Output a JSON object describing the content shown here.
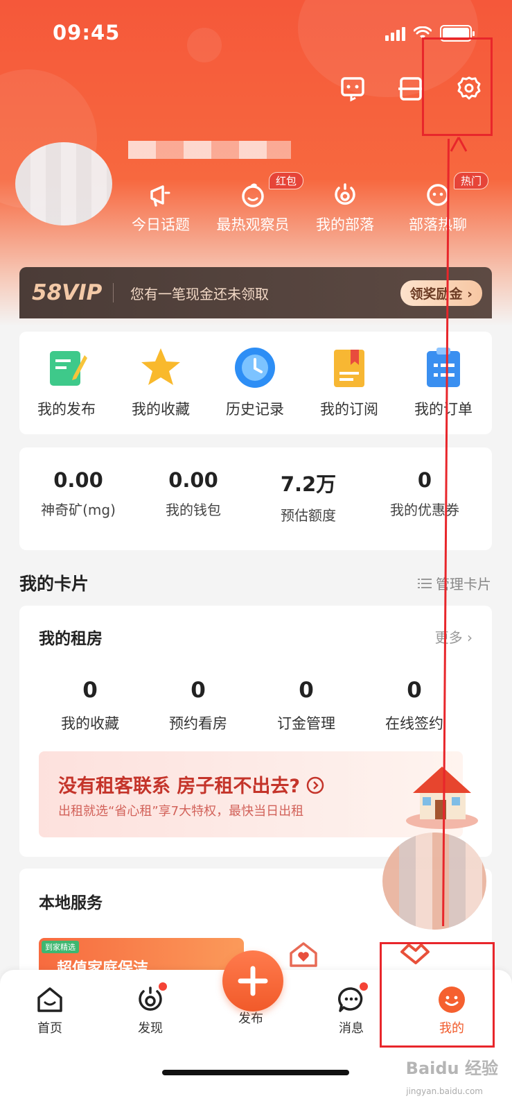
{
  "status_bar": {
    "time": "09:45"
  },
  "quick_links": [
    {
      "label": "今日话题",
      "icon": "megaphone-icon"
    },
    {
      "label": "最热观察员",
      "icon": "smile-bubble-icon",
      "badge": "红包"
    },
    {
      "label": "我的部落",
      "icon": "tribe-icon"
    },
    {
      "label": "部落热聊",
      "icon": "chat-face-icon",
      "badge": "热门"
    }
  ],
  "vip": {
    "logo": "58VIP",
    "text": "您有一笔现金还未领取",
    "button": "领奖励金"
  },
  "menu": [
    {
      "label": "我的发布",
      "icon": "notebook-pen-icon",
      "color": "#3ec98a"
    },
    {
      "label": "我的收藏",
      "icon": "star-icon",
      "color": "#f9b92c"
    },
    {
      "label": "历史记录",
      "icon": "clock-icon",
      "color": "#2d8ef5"
    },
    {
      "label": "我的订阅",
      "icon": "bookmark-book-icon",
      "color": "#f7b733"
    },
    {
      "label": "我的订单",
      "icon": "clipboard-icon",
      "color": "#3a8ff0"
    }
  ],
  "stats": [
    {
      "value": "0.00",
      "label": "神奇矿(mg)"
    },
    {
      "value": "0.00",
      "label": "我的钱包"
    },
    {
      "value": "7.2万",
      "label": "预估额度"
    },
    {
      "value": "0",
      "label": "我的优惠券"
    }
  ],
  "cards_section": {
    "title": "我的卡片",
    "manage": "管理卡片"
  },
  "rent": {
    "title": "我的租房",
    "more": "更多",
    "stats": [
      {
        "value": "0",
        "label": "我的收藏"
      },
      {
        "value": "0",
        "label": "预约看房"
      },
      {
        "value": "0",
        "label": "订金管理"
      },
      {
        "value": "0",
        "label": "在线签约"
      }
    ],
    "promo_title": "没有租客联系 房子租不出去?",
    "promo_sub": "出租就选“省心租”享7大特权，最快当日出租"
  },
  "local": {
    "title": "本地服务",
    "banner_tag": "到家精选",
    "banner_title": "超值家庭保洁"
  },
  "tabs": [
    {
      "label": "首页",
      "icon": "home-icon"
    },
    {
      "label": "发现",
      "icon": "discover-icon"
    },
    {
      "label": "发布",
      "icon": "plus-icon"
    },
    {
      "label": "消息",
      "icon": "message-icon"
    },
    {
      "label": "我的",
      "icon": "profile-face-icon"
    }
  ],
  "watermark": {
    "brand": "Baidu 经验",
    "url": "jingyan.baidu.com"
  },
  "colors": {
    "accent": "#f5583a",
    "annotation": "#e8262b"
  }
}
